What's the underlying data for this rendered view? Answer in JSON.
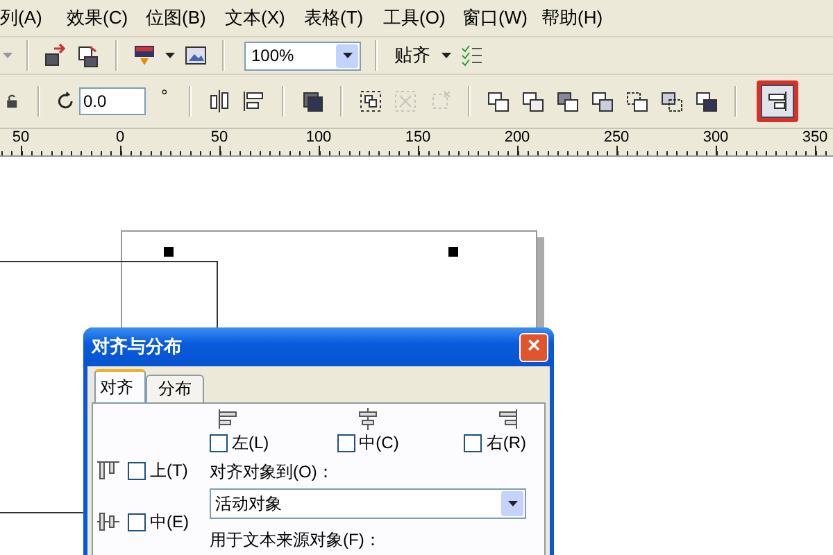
{
  "menu_bar": {
    "items": [
      "列(A)",
      "效果(C)",
      "位图(B)",
      "文本(X)",
      "表格(T)",
      "工具(O)",
      "窗口(W)",
      "帮助(H)"
    ]
  },
  "standard_toolbar": {
    "zoom": "100%",
    "snap_label": "贴齐"
  },
  "property_bar": {
    "angle": "0.0",
    "degree_sign": "°",
    "align_button": {
      "pressed": true,
      "highlighted": true
    }
  },
  "ruler": {
    "labels": [
      "50",
      "0",
      "50",
      "100",
      "150",
      "200",
      "250",
      "300",
      "350"
    ]
  },
  "dialog": {
    "title": "对齐与分布",
    "close_glyph": "×",
    "tabs": [
      {
        "label": "对齐",
        "selected": true
      },
      {
        "label": "分布",
        "selected": false
      }
    ],
    "horizontal_options": [
      {
        "label": "左(L)",
        "checked": false
      },
      {
        "label": "中(C)",
        "checked": false
      },
      {
        "label": "右(R)",
        "checked": false
      }
    ],
    "vertical_options": [
      {
        "label": "上(T)",
        "checked": false
      },
      {
        "label": "中(E)",
        "checked": false
      }
    ],
    "align_to_label": "对齐对象到(O)：",
    "align_to_value": "活动对象",
    "text_source_label": "用于文本来源对象(F)："
  }
}
